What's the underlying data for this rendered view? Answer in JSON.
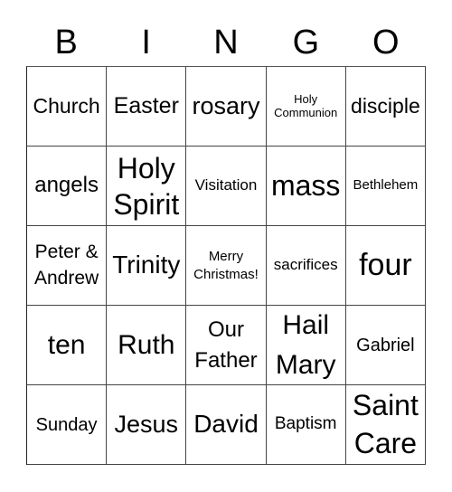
{
  "header": {
    "letters": [
      "B",
      "I",
      "N",
      "G",
      "O"
    ]
  },
  "board": {
    "rows": [
      [
        "Church",
        "Easter",
        "rosary",
        "Holy\nCommunion",
        "disciple"
      ],
      [
        "angels",
        "Holy\nSpirit",
        "Visitation",
        "mass",
        "Bethlehem"
      ],
      [
        "Peter &\nAndrew",
        "Trinity",
        "Merry\nChristmas!",
        "sacrifices",
        "four"
      ],
      [
        "ten",
        "Ruth",
        "Our\nFather",
        "Hail\nMary",
        "Gabriel"
      ],
      [
        "Sunday",
        "Jesus",
        "David",
        "Baptism",
        "Saint\nCare"
      ]
    ]
  }
}
